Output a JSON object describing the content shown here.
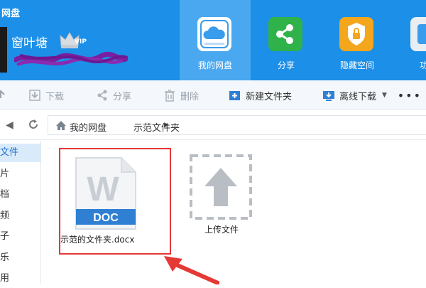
{
  "app": {
    "title": "网盘"
  },
  "user": {
    "name": "窗叶塘",
    "vip_label": "VIP"
  },
  "nav_tabs": [
    {
      "label": "我的网盘",
      "icon": "cloud-icon",
      "active": true
    },
    {
      "label": "分享",
      "icon": "share-icon",
      "active": false
    },
    {
      "label": "隐藏空间",
      "icon": "lock-icon",
      "active": false
    },
    {
      "label": "功能",
      "icon": "tools-icon",
      "active": false
    }
  ],
  "toolbar": {
    "download": "下载",
    "share": "分享",
    "delete": "删除",
    "new_folder": "新建文件夹",
    "offline_download": "离线下载"
  },
  "breadcrumb": {
    "root": "我的网盘",
    "current": "示范文件夹"
  },
  "sidebar": {
    "items": [
      {
        "label": "文件",
        "active": true
      },
      {
        "label": "片",
        "active": false
      },
      {
        "label": "档",
        "active": false
      },
      {
        "label": "频",
        "active": false
      },
      {
        "label": "子",
        "active": false
      },
      {
        "label": "乐",
        "active": false
      },
      {
        "label": "用",
        "active": false
      }
    ]
  },
  "files": [
    {
      "name": "示范的文件夹.docx",
      "type_label": "DOC",
      "badge_letter": "W"
    }
  ],
  "upload": {
    "label": "上传文件"
  },
  "colors": {
    "header": "#1c8fe8",
    "active_tab": "#4aa8f0",
    "highlight": "#e53935",
    "doc_badge": "#2f7fd3"
  }
}
